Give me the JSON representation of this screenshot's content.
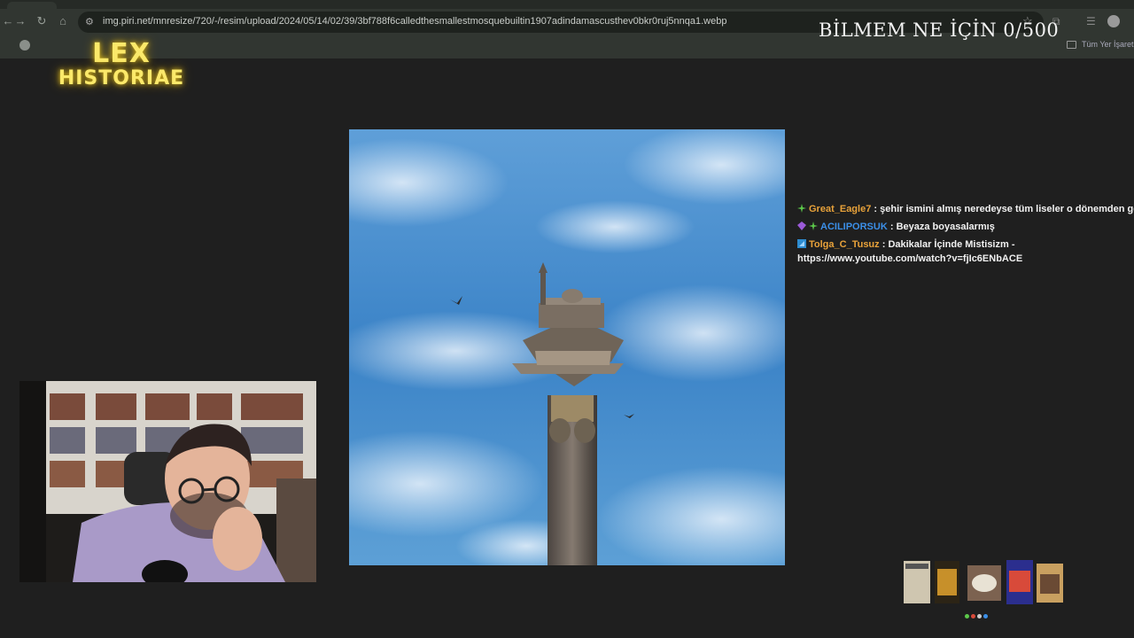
{
  "browser": {
    "url": "img.piri.net/mnresize/720/-/resim/upload/2024/05/14/02/39/3bf788f6calledthesmallestmosquebuiltin1907adindamascusthev0bkr0ruj5nnqa1.webp",
    "bookmarks_folder_label": "Tüm Yer İşaretleri"
  },
  "overlay": {
    "title": "BİLMEM NE İÇİN 0/500"
  },
  "logo": {
    "line1": "LEX",
    "line2": "HISTORIAE"
  },
  "chat": {
    "messages": [
      {
        "user": "Great_Eagle7",
        "user_color": "#e8a23a",
        "text": "şehir ismini almış neredeyse tüm liseler o dönemden gelme"
      },
      {
        "user": "ACILIPORSUK",
        "user_color": "#3b8fe8",
        "text": "Beyaza boyasalarmış"
      },
      {
        "user": "Tolga_C_Tusuz",
        "user_color": "#e8a23a",
        "text": "Dakikalar İçinde Mistisizm -",
        "link": "https://www.youtube.com/watch?v=fjIc6ENbACE"
      }
    ]
  },
  "colors": {
    "chrome_bg": "#313631",
    "page_bg": "#1f1f1f",
    "logo_yellow": "#fbe96a",
    "sky_blue": "#3f86c6"
  },
  "icons": [
    "back-icon",
    "forward-icon",
    "reload-icon",
    "home-icon",
    "site-info-icon",
    "bookmark-star-icon",
    "extensions-icon",
    "profile-avatar-icon",
    "folder-icon"
  ]
}
